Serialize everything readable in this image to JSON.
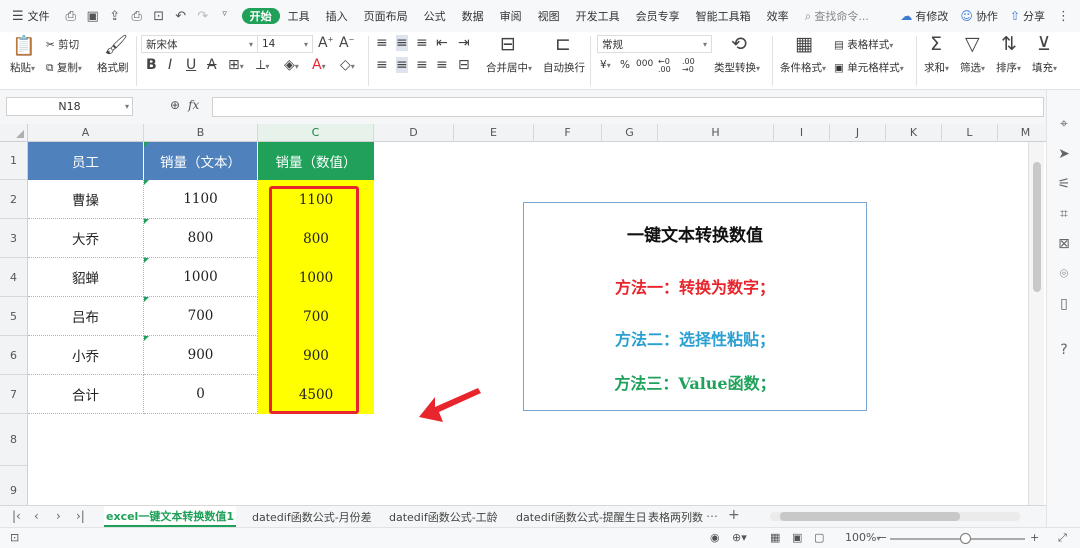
{
  "menubar": {
    "file_label": "文件",
    "tabs": [
      "开始",
      "工具",
      "插入",
      "页面布局",
      "公式",
      "数据",
      "审阅",
      "视图",
      "开发工具",
      "会员专享",
      "智能工具箱",
      "效率"
    ],
    "search_placeholder": "查找命令...",
    "right": {
      "edit": "有修改",
      "collab": "协作",
      "share": "分享"
    }
  },
  "ribbon": {
    "paste": "粘贴",
    "cut": "剪切",
    "copy": "复制",
    "format_painter": "格式刷",
    "font_name": "新宋体",
    "font_size": "14",
    "merge_center": "合并居中",
    "wrap_text": "自动换行",
    "number_format": "常规",
    "currency": "¥",
    "percent": "%",
    "thousands": "000",
    "type_convert": "类型转换",
    "conditional_format": "条件格式",
    "table_style": "表格样式",
    "cell_style": "单元格样式",
    "sum": "求和",
    "filter": "筛选",
    "sort": "排序",
    "fill": "填充"
  },
  "formula_bar": {
    "name_box": "N18",
    "fx": "fx",
    "value": ""
  },
  "columns": [
    "A",
    "B",
    "C",
    "D",
    "E",
    "F",
    "G",
    "H",
    "I",
    "J",
    "K",
    "L",
    "M"
  ],
  "rows": [
    "1",
    "2",
    "3",
    "4",
    "5",
    "6",
    "7",
    "8",
    "9"
  ],
  "table": {
    "headers": [
      "员工",
      "销量（文本）",
      "销量（数值）"
    ],
    "body": [
      [
        "曹操",
        "1100",
        "1100"
      ],
      [
        "大乔",
        "800",
        "800"
      ],
      [
        "貂蝉",
        "1000",
        "1000"
      ],
      [
        "吕布",
        "700",
        "700"
      ],
      [
        "小乔",
        "900",
        "900"
      ],
      [
        "合计",
        "0",
        "4500"
      ]
    ]
  },
  "note": {
    "title": "一键文本转换数值",
    "method1": "方法一：转换为数字；",
    "method2": "方法二：选择性粘贴；",
    "method3": "方法三：Value函数；",
    "colors": {
      "method1": "#e8252d",
      "method2": "#2aa0d2",
      "method3": "#1fa15a"
    }
  },
  "sheet_tabs": [
    "excel一键文本转换数值1",
    "datedif函数公式-月份差",
    "datedif函数公式-工龄",
    "datedif函数公式-提醒生日",
    "表格两列数"
  ],
  "status": {
    "zoom": "100%"
  },
  "colors": {
    "accent": "#1fa15a",
    "header_blue": "#4f81bd",
    "highlight": "#ffff00",
    "red_box": "#e8252d"
  }
}
